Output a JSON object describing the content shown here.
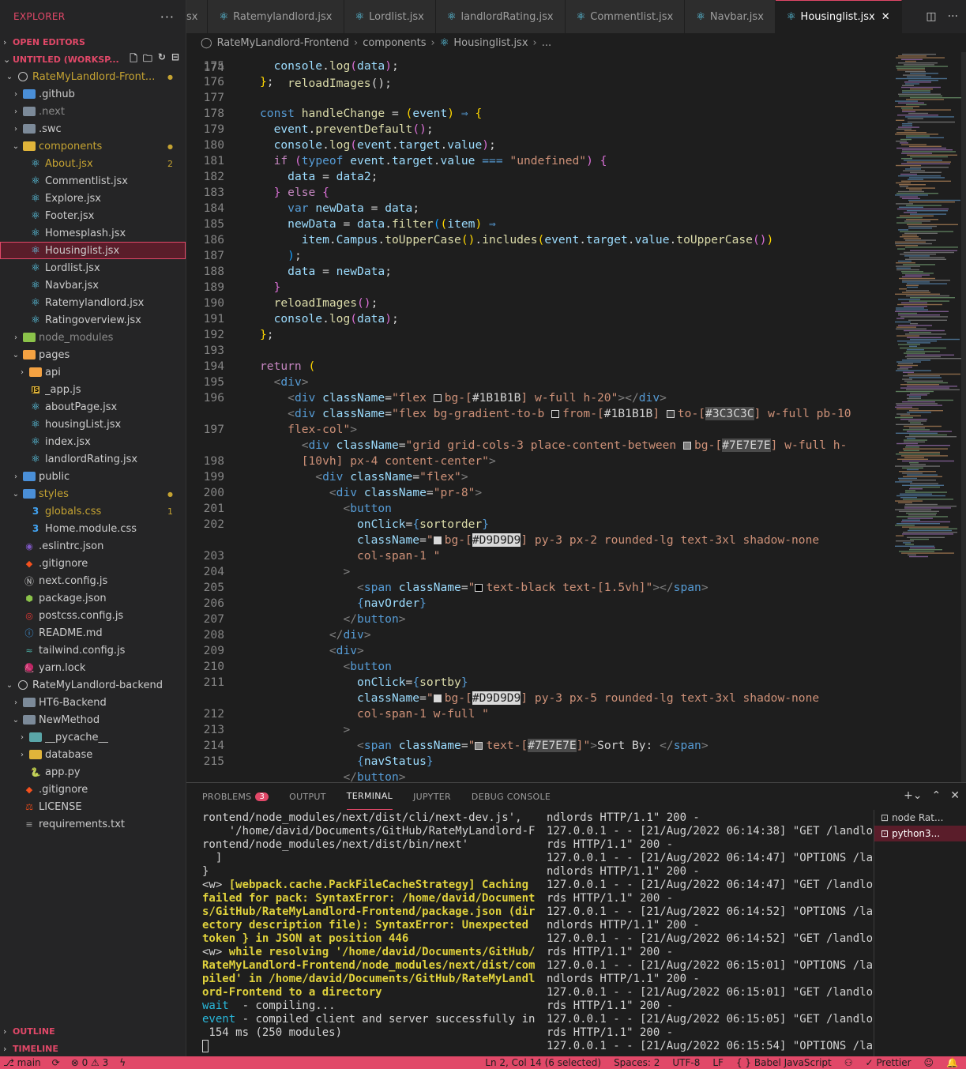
{
  "explorer": {
    "title": "EXPLORER",
    "open_editors": "OPEN EDITORS",
    "workspace": "UNTITLED (WORKSP...",
    "outline": "OUTLINE",
    "timeline": "TIMELINE",
    "tree": [
      {
        "depth": 1,
        "chev": "⌄",
        "icon": "circle",
        "label": "RateMyLandlord-Front...",
        "badge": "●",
        "color": "c-yellow"
      },
      {
        "depth": 2,
        "chev": "›",
        "icon": "folder-blue",
        "label": ".github"
      },
      {
        "depth": 2,
        "chev": "›",
        "icon": "folder",
        "label": ".next",
        "color": "c-dim"
      },
      {
        "depth": 2,
        "chev": "›",
        "icon": "folder",
        "label": ".swc"
      },
      {
        "depth": 2,
        "chev": "⌄",
        "icon": "folder-yellow",
        "label": "components",
        "badge": "●",
        "color": "c-yellow"
      },
      {
        "depth": 3,
        "icon": "react",
        "label": "About.jsx",
        "badge": "2",
        "color": "c-yellow"
      },
      {
        "depth": 3,
        "icon": "react",
        "label": "Commentlist.jsx"
      },
      {
        "depth": 3,
        "icon": "react",
        "label": "Explore.jsx"
      },
      {
        "depth": 3,
        "icon": "react",
        "label": "Footer.jsx"
      },
      {
        "depth": 3,
        "icon": "react",
        "label": "Homesplash.jsx"
      },
      {
        "depth": 3,
        "icon": "react",
        "label": "Housinglist.jsx",
        "selected": true
      },
      {
        "depth": 3,
        "icon": "react",
        "label": "Lordlist.jsx"
      },
      {
        "depth": 3,
        "icon": "react",
        "label": "Navbar.jsx"
      },
      {
        "depth": 3,
        "icon": "react",
        "label": "Ratemylandlord.jsx"
      },
      {
        "depth": 3,
        "icon": "react",
        "label": "Ratingoverview.jsx"
      },
      {
        "depth": 2,
        "chev": "›",
        "icon": "folder-lime",
        "label": "node_modules",
        "color": "c-dim"
      },
      {
        "depth": 2,
        "chev": "⌄",
        "icon": "folder-orange",
        "label": "pages"
      },
      {
        "depth": 3,
        "chev": "›",
        "icon": "folder-orange",
        "label": "api"
      },
      {
        "depth": 3,
        "icon": "js",
        "label": "_app.js"
      },
      {
        "depth": 3,
        "icon": "react",
        "label": "aboutPage.jsx"
      },
      {
        "depth": 3,
        "icon": "react",
        "label": "housingList.jsx"
      },
      {
        "depth": 3,
        "icon": "react",
        "label": "index.jsx"
      },
      {
        "depth": 3,
        "icon": "react",
        "label": "landlordRating.jsx"
      },
      {
        "depth": 2,
        "chev": "›",
        "icon": "folder-blue",
        "label": "public"
      },
      {
        "depth": 2,
        "chev": "⌄",
        "icon": "folder-blue",
        "label": "styles",
        "badge": "●",
        "color": "c-yellow"
      },
      {
        "depth": 3,
        "icon": "css",
        "label": "globals.css",
        "badge": "1",
        "color": "c-yellow"
      },
      {
        "depth": 3,
        "icon": "css",
        "label": "Home.module.css"
      },
      {
        "depth": 2,
        "icon": "eslint",
        "label": ".eslintrc.json"
      },
      {
        "depth": 2,
        "icon": "git",
        "label": ".gitignore"
      },
      {
        "depth": 2,
        "icon": "next",
        "label": "next.config.js"
      },
      {
        "depth": 2,
        "icon": "node",
        "label": "package.json"
      },
      {
        "depth": 2,
        "icon": "postcss",
        "label": "postcss.config.js"
      },
      {
        "depth": 2,
        "icon": "info",
        "label": "README.md"
      },
      {
        "depth": 2,
        "icon": "tailwind",
        "label": "tailwind.config.js"
      },
      {
        "depth": 2,
        "icon": "yarn",
        "label": "yarn.lock"
      },
      {
        "depth": 1,
        "chev": "⌄",
        "icon": "circle",
        "label": "RateMyLandlord-backend"
      },
      {
        "depth": 2,
        "chev": "›",
        "icon": "folder",
        "label": "HT6-Backend"
      },
      {
        "depth": 2,
        "chev": "⌄",
        "icon": "folder",
        "label": "NewMethod"
      },
      {
        "depth": 3,
        "chev": "›",
        "icon": "folder-teal",
        "label": "__pycache__"
      },
      {
        "depth": 3,
        "chev": "›",
        "icon": "folder-yellow",
        "label": "database"
      },
      {
        "depth": 3,
        "icon": "python",
        "label": "app.py"
      },
      {
        "depth": 2,
        "icon": "git",
        "label": ".gitignore"
      },
      {
        "depth": 2,
        "icon": "license",
        "label": "LICENSE"
      },
      {
        "depth": 2,
        "icon": "text",
        "label": "requirements.txt"
      }
    ]
  },
  "tabs": [
    {
      "label": "sx",
      "partial": true
    },
    {
      "label": "Ratemylandlord.jsx"
    },
    {
      "label": "Lordlist.jsx"
    },
    {
      "label": "landlordRating.jsx"
    },
    {
      "label": "Commentlist.jsx"
    },
    {
      "label": "Navbar.jsx"
    },
    {
      "label": "Housinglist.jsx",
      "active": true
    }
  ],
  "breadcrumb": {
    "root": "RateMyLandlord-Frontend",
    "folder": "components",
    "file": "Housinglist.jsx",
    "more": "..."
  },
  "editor": {
    "line_numbers": [
      "175",
      "176",
      "177",
      "178",
      "179",
      "180",
      "181",
      "182",
      "183",
      "184",
      "185",
      "186",
      "187",
      "188",
      "189",
      "190",
      "191",
      "192",
      "193",
      "194",
      "195",
      "196",
      "",
      "197",
      "",
      "198",
      "199",
      "200",
      "201",
      "202",
      "",
      "203",
      "204",
      "205",
      "206",
      "207",
      "208",
      "209",
      "210",
      "211",
      "",
      "212",
      "213",
      "214",
      "215"
    ],
    "top_partial_line": {
      "number": "174",
      "text": "    console.log(data);"
    }
  },
  "panel": {
    "tabs": [
      "PROBLEMS",
      "OUTPUT",
      "TERMINAL",
      "JUPYTER",
      "DEBUG CONSOLE"
    ],
    "problems_count": "3",
    "terminals": [
      {
        "label": "node  Rat...",
        "active": false
      },
      {
        "label": "python3...",
        "active": true
      }
    ]
  },
  "statusbar": {
    "branch": "main",
    "errors": "0",
    "warnings": "3",
    "position": "Ln 2, Col 14 (6 selected)",
    "spaces": "Spaces: 2",
    "encoding": "UTF-8",
    "eol": "LF",
    "language": "{ }  Babel JavaScript",
    "prettier": "Prettier"
  },
  "colors": {
    "accent": "#e14868",
    "background": "#1e1e1e",
    "sidebar": "#252526"
  }
}
